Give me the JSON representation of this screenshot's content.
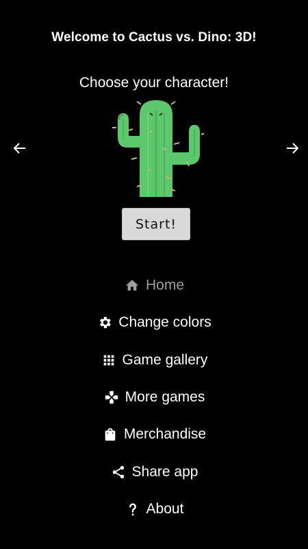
{
  "header": {
    "title": "Welcome to Cactus vs. Dino: 3D!",
    "subtitle": "Choose your character!"
  },
  "character_select": {
    "prev_icon": "arrow-left-icon",
    "next_icon": "arrow-right-icon",
    "current_character": "cactus"
  },
  "start_button": {
    "label": "Start!"
  },
  "menu": {
    "items": [
      {
        "label": "Home",
        "icon": "home-icon",
        "active": true
      },
      {
        "label": "Change colors",
        "icon": "gear-icon",
        "active": false
      },
      {
        "label": "Game gallery",
        "icon": "grid-icon",
        "active": false
      },
      {
        "label": "More games",
        "icon": "gamepad-icon",
        "active": false
      },
      {
        "label": "Merchandise",
        "icon": "shopping-bag-icon",
        "active": false
      },
      {
        "label": "Share app",
        "icon": "share-icon",
        "active": false
      },
      {
        "label": "About",
        "icon": "question-icon",
        "active": false
      }
    ]
  },
  "colors": {
    "background": "#000000",
    "text": "#ffffff",
    "active_menu_text": "#9e9e9e",
    "button_bg": "#d9d9d9",
    "cactus_green": "#5cc86c"
  }
}
